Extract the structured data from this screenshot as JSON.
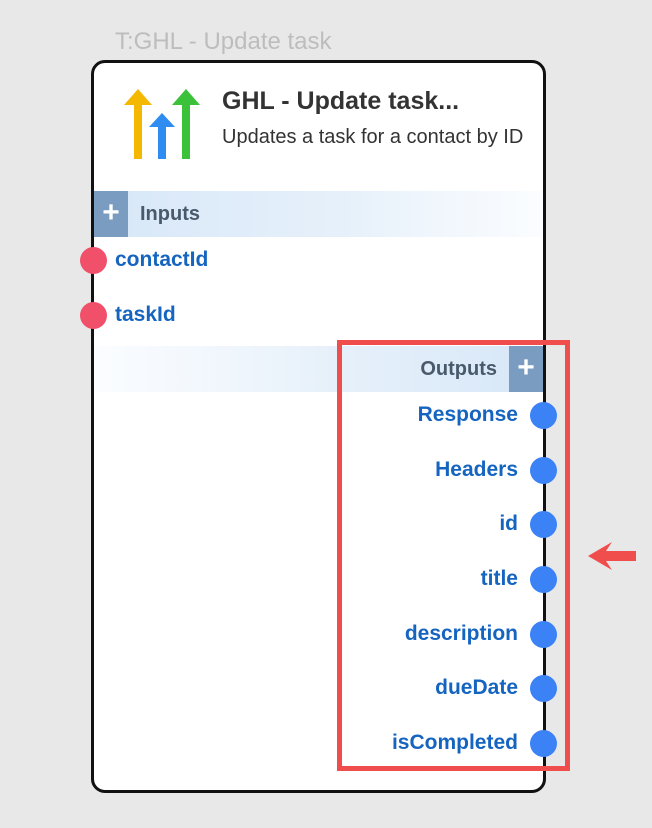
{
  "node": {
    "caption": "T:GHL - Update task",
    "title": "GHL - Update task...",
    "description": "Updates a task for a contact by ID",
    "logo_icon": "ghl-logo-icon"
  },
  "inputs": {
    "label": "Inputs",
    "add_symbol": "+",
    "ports": [
      {
        "label": "contactId"
      },
      {
        "label": "taskId"
      }
    ]
  },
  "outputs": {
    "label": "Outputs",
    "add_symbol": "+",
    "ports": [
      {
        "label": "Response"
      },
      {
        "label": "Headers"
      },
      {
        "label": "id"
      },
      {
        "label": "title"
      },
      {
        "label": "description"
      },
      {
        "label": "dueDate"
      },
      {
        "label": "isCompleted"
      }
    ]
  },
  "colors": {
    "input_port": "#f0506a",
    "output_port": "#3b82f6",
    "port_label": "#1565c0",
    "highlight": "#f04d4d",
    "logo_yellow": "#f5b800",
    "logo_blue": "#2f8cf0",
    "logo_green": "#3cc13b"
  }
}
